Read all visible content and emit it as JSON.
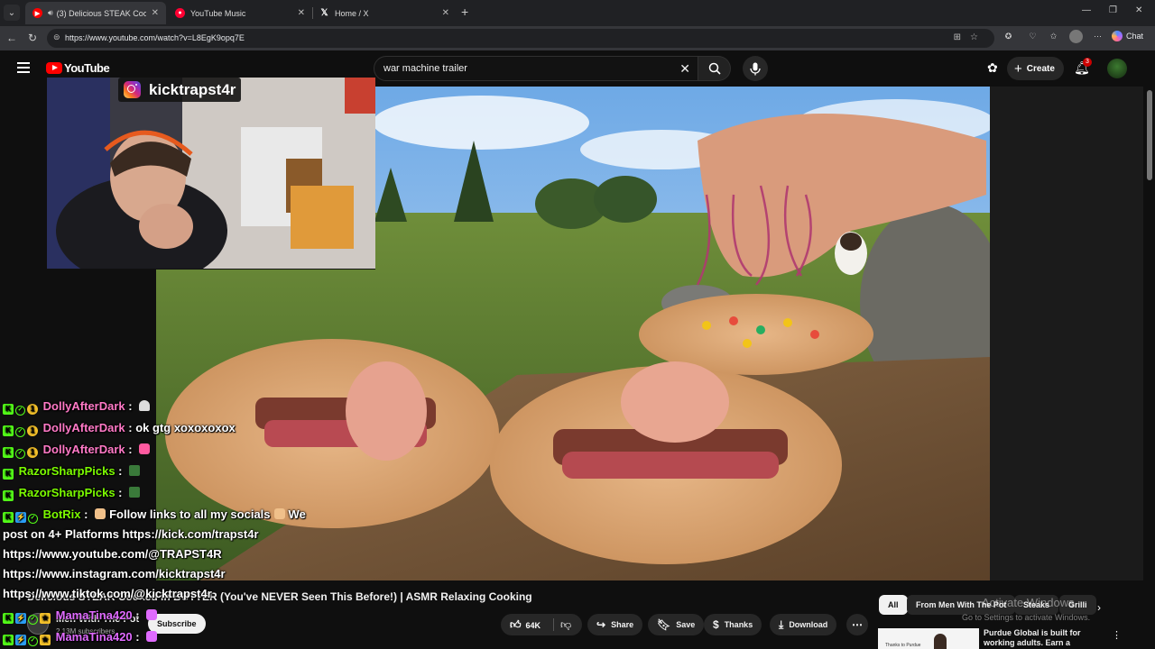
{
  "browser": {
    "tabs": [
      {
        "title": "(3) Delicious STEAK Cooked in",
        "favicon": "youtube-icon",
        "active": true
      },
      {
        "title": "YouTube Music",
        "favicon": "youtube-music-icon",
        "active": false
      },
      {
        "title": "Home / X",
        "favicon": "x-icon",
        "active": false
      }
    ],
    "url": "https://www.youtube.com/watch?v=L8EgK9opq7E",
    "chat_button": "Chat"
  },
  "youtube": {
    "logo_text": "YouTube",
    "search": {
      "value": "war machine trailer"
    },
    "create_label": "Create",
    "notification_count": "3",
    "video": {
      "title": "Delicious STEAK Cooked in BUTTER (You've NEVER Seen This Before!) | ASMR Relaxing Cooking",
      "channel": "Men With The Pot",
      "subscribers": "2.13M subscribers",
      "subscribe_label": "Subscribe",
      "likes": "64K",
      "actions": {
        "share": "Share",
        "save": "Save",
        "thanks": "Thanks",
        "download": "Download"
      }
    },
    "chips": [
      "All",
      "From Men With The Pot",
      "Steaks",
      "Grilli"
    ],
    "ad": {
      "title": "Purdue Global is built for working adults. Earn a degree...",
      "thumb_text": "Thanks to Purdue"
    }
  },
  "overlay": {
    "instagram_handle": "kicktrapst4r",
    "chat": [
      {
        "user": "DollyAfterDark",
        "text": "",
        "color": "#ff79c6"
      },
      {
        "user": "DollyAfterDark",
        "text": "ok gtg xoxoxoxox",
        "color": "#ff79c6"
      },
      {
        "user": "DollyAfterDark",
        "text": "",
        "color": "#ff79c6"
      },
      {
        "user": "RazorSharpPicks",
        "text": "",
        "color": "#7CFC00"
      },
      {
        "user": "RazorSharpPicks",
        "text": "",
        "color": "#7CFC00"
      },
      {
        "user": "BotRix",
        "text": "Follow links to all my socials",
        "color": "#7CFC00",
        "text_end": "We"
      },
      {
        "line": "post on 4+ Platforms https://kick.com/trapst4r"
      },
      {
        "line": "https://www.youtube.com/@TRAPST4R"
      },
      {
        "line": "https://www.instagram.com/kicktrapst4r"
      },
      {
        "line": "https://www.tiktok.com/@kicktrapst4r"
      },
      {
        "user": "MamaTina420",
        "text": "",
        "color": "#e06bff"
      },
      {
        "user": "MamaTina420",
        "text": "",
        "color": "#e06bff"
      }
    ]
  },
  "system": {
    "watermark_title": "Activate Windows",
    "watermark_sub": "Go to Settings to activate Windows."
  }
}
